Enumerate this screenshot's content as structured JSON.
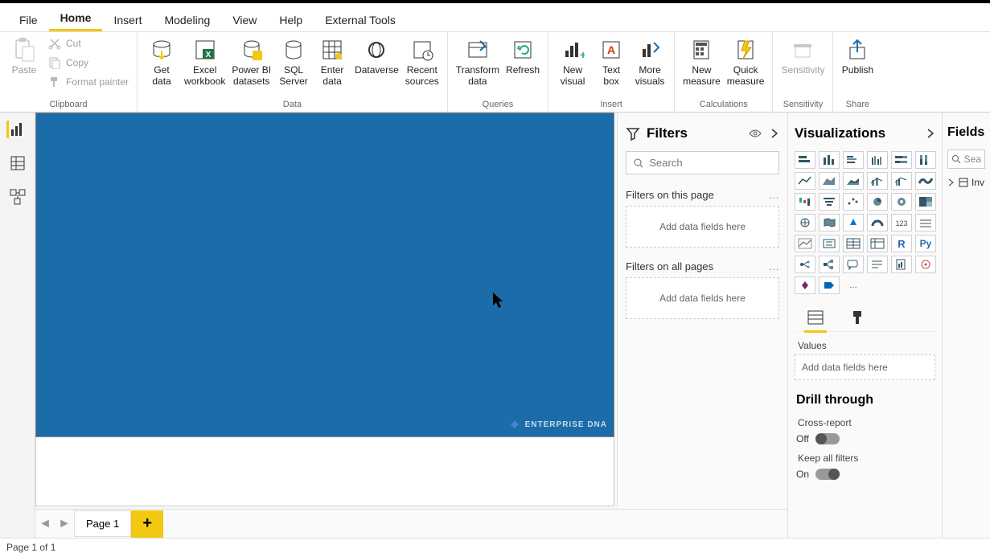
{
  "tabs": [
    "File",
    "Home",
    "Insert",
    "Modeling",
    "View",
    "Help",
    "External Tools"
  ],
  "active_tab": "Home",
  "ribbon": {
    "clipboard": {
      "paste": "Paste",
      "cut": "Cut",
      "copy": "Copy",
      "format_painter": "Format painter",
      "group_label": "Clipboard"
    },
    "data": {
      "get_data": "Get\ndata",
      "excel": "Excel\nworkbook",
      "pbi_ds": "Power BI\ndatasets",
      "sql": "SQL\nServer",
      "enter": "Enter\ndata",
      "dataverse": "Dataverse",
      "recent": "Recent\nsources",
      "group_label": "Data"
    },
    "queries": {
      "transform": "Transform\ndata",
      "refresh": "Refresh",
      "group_label": "Queries"
    },
    "insert": {
      "new_visual": "New\nvisual",
      "text_box": "Text\nbox",
      "more_visuals": "More\nvisuals",
      "group_label": "Insert"
    },
    "calc": {
      "new_measure": "New\nmeasure",
      "quick_measure": "Quick\nmeasure",
      "group_label": "Calculations"
    },
    "sensitivity": {
      "label": "Sensitivity",
      "group_label": "Sensitivity"
    },
    "share": {
      "publish": "Publish",
      "group_label": "Share"
    }
  },
  "filters": {
    "title": "Filters",
    "search_placeholder": "Search",
    "page_filters": "Filters on this page",
    "all_filters": "Filters on all pages",
    "drop_hint": "Add data fields here"
  },
  "viz": {
    "title": "Visualizations",
    "values_label": "Values",
    "values_hint": "Add data fields here",
    "drill_title": "Drill through",
    "cross_report": "Cross-report",
    "cross_report_state": "Off",
    "keep_filters": "Keep all filters",
    "keep_filters_state": "On",
    "r_label": "R",
    "py_label": "Py"
  },
  "fields": {
    "title": "Fields",
    "search_placeholder": "Sea",
    "table1": "Inv"
  },
  "page_tab": "Page 1",
  "status": "Page 1 of 1",
  "watermark": "ENTERPRISE DNA"
}
